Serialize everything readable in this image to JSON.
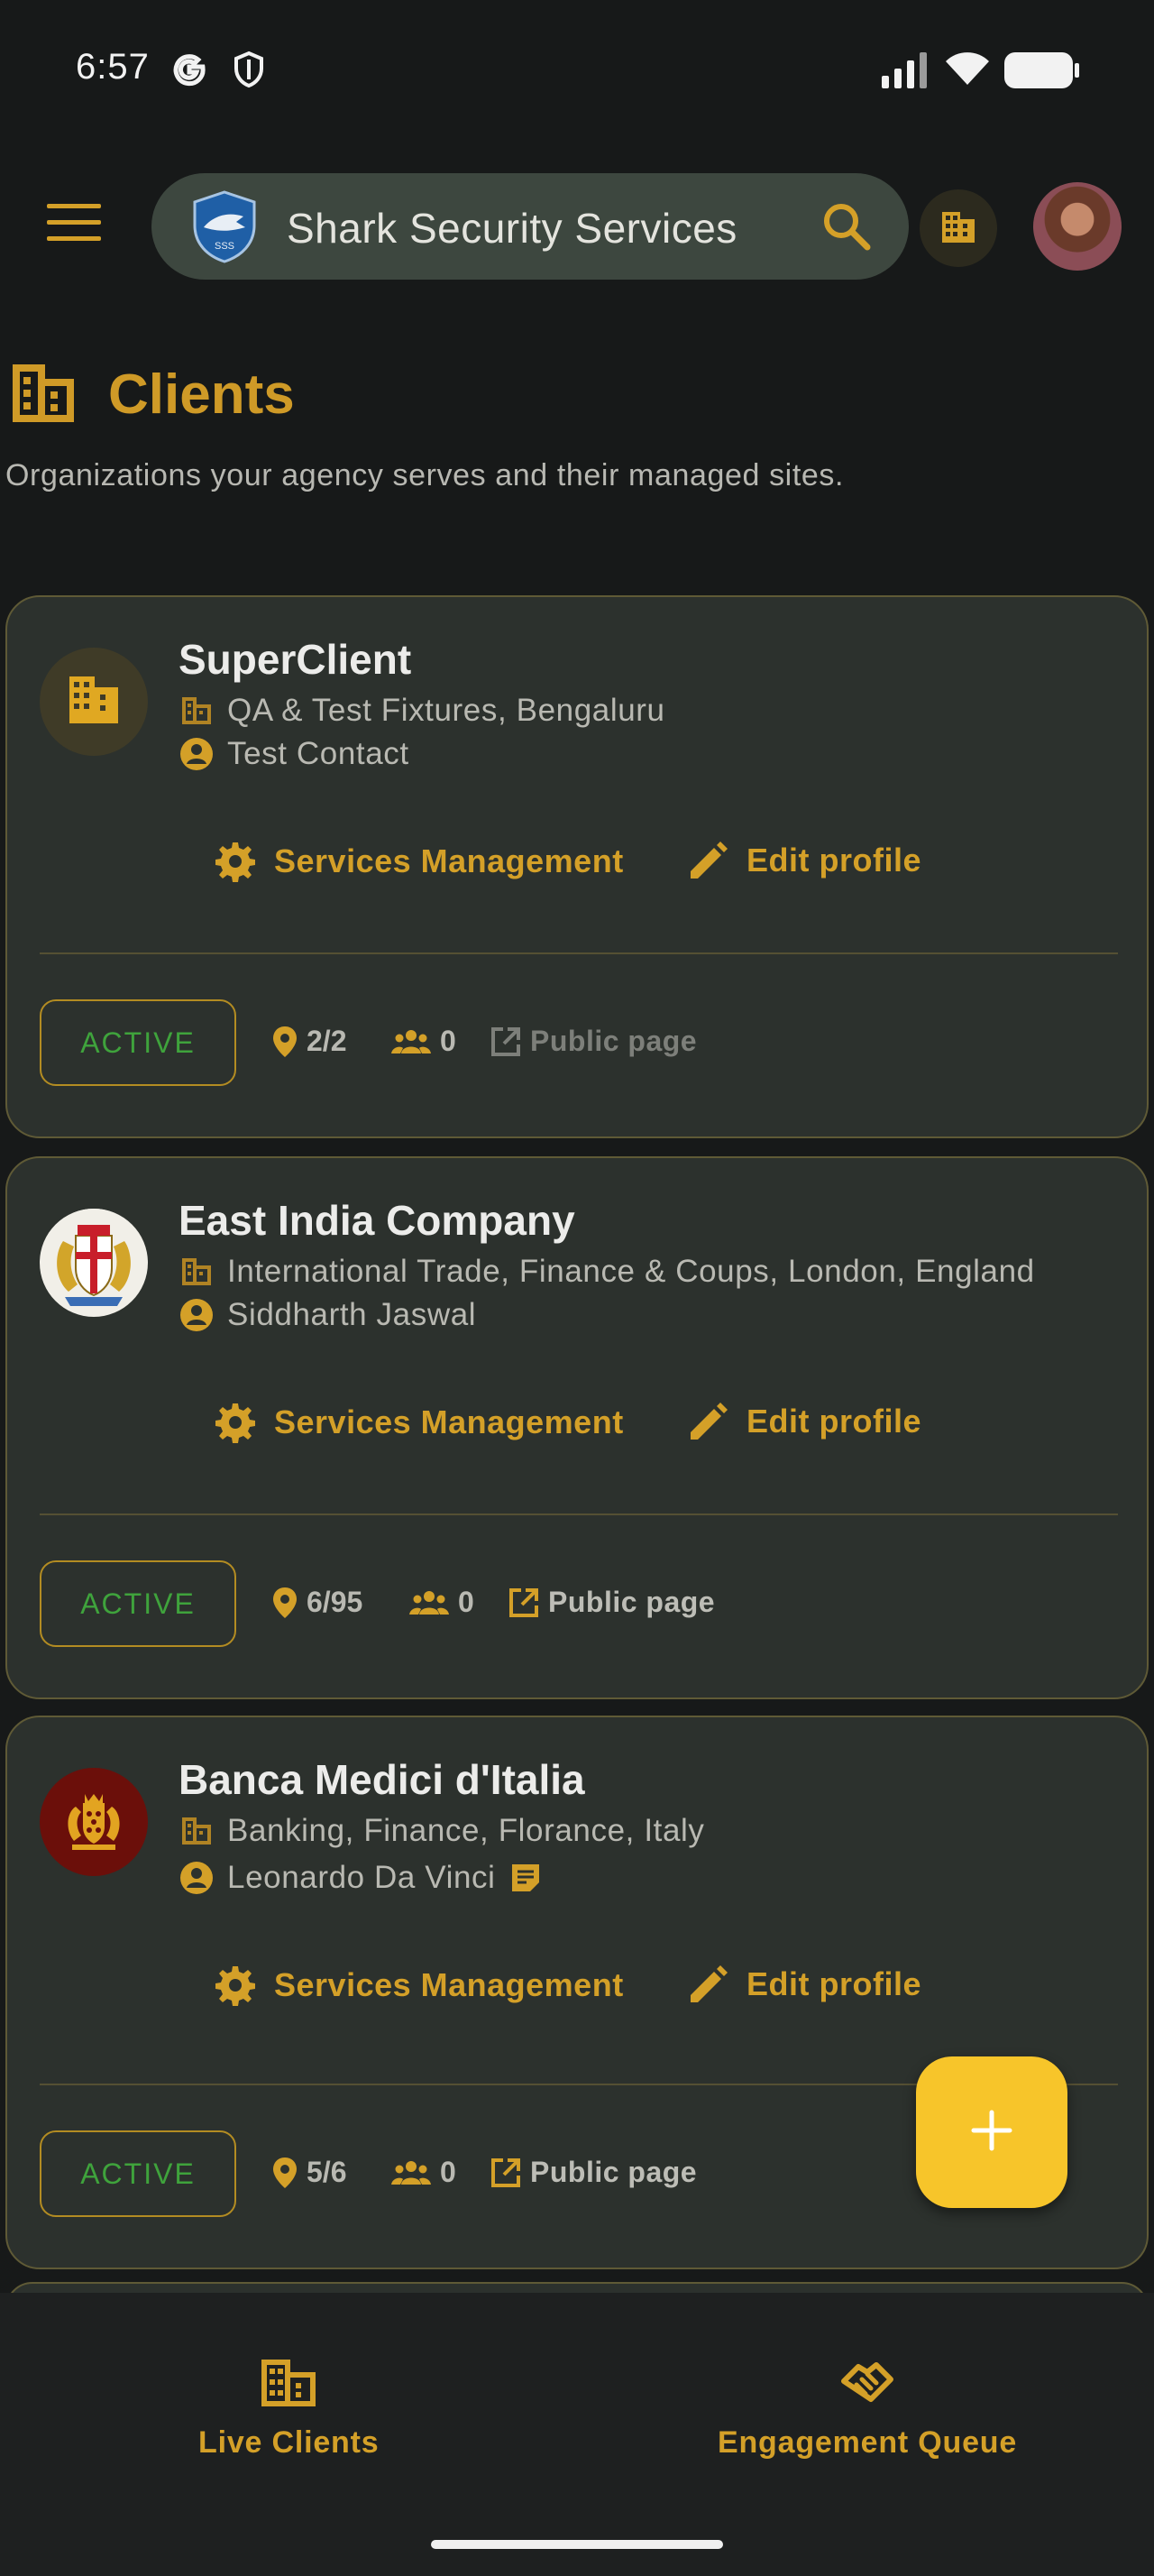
{
  "status_bar": {
    "time": "6:57",
    "icons": [
      "google-icon",
      "shield-icon",
      "signal-icon",
      "wifi-icon",
      "battery-icon"
    ]
  },
  "app_bar": {
    "menu_icon": "menu-icon",
    "logo_text": "SSS",
    "search_title": "Shark Security Services",
    "search_icon": "search-icon",
    "org_icon": "building-icon",
    "avatar": "user-avatar"
  },
  "header": {
    "title": "Clients",
    "subtitle": "Organizations your agency serves and their managed sites."
  },
  "actions": {
    "services_label": "Services Management",
    "edit_label": "Edit profile",
    "public_label": "Public page"
  },
  "clients": [
    {
      "name": "SuperClient",
      "industry_location": "QA & Test Fixtures, Bengaluru",
      "contact": "Test Contact",
      "status": "ACTIVE",
      "sites": "2/2",
      "members": "0",
      "public_enabled": false,
      "avatar_icon": "building-icon"
    },
    {
      "name": "East India Company",
      "industry_location": "International Trade, Finance & Coups, London, England",
      "contact": "Siddharth Jaswal",
      "status": "ACTIVE",
      "sites": "6/95",
      "members": "0",
      "public_enabled": true,
      "avatar_icon": "coat-of-arms-icon"
    },
    {
      "name": "Banca Medici d'Italia",
      "industry_location": "Banking, Finance, Florance, Italy",
      "contact": "Leonardo Da Vinci",
      "status": "ACTIVE",
      "sites": "5/6",
      "members": "0",
      "public_enabled": true,
      "avatar_icon": "crest-icon"
    }
  ],
  "fab": {
    "icon": "plus-icon"
  },
  "bottom_nav": {
    "items": [
      {
        "label": "Live Clients",
        "icon": "building-icon",
        "active": true
      },
      {
        "label": "Engagement Queue",
        "icon": "handshake-icon",
        "active": false
      }
    ]
  },
  "colors": {
    "background": "#171919",
    "card": "#2c312d",
    "accent": "#d4a028",
    "fab": "#f7c52a",
    "status_active": "#3fa33c"
  }
}
